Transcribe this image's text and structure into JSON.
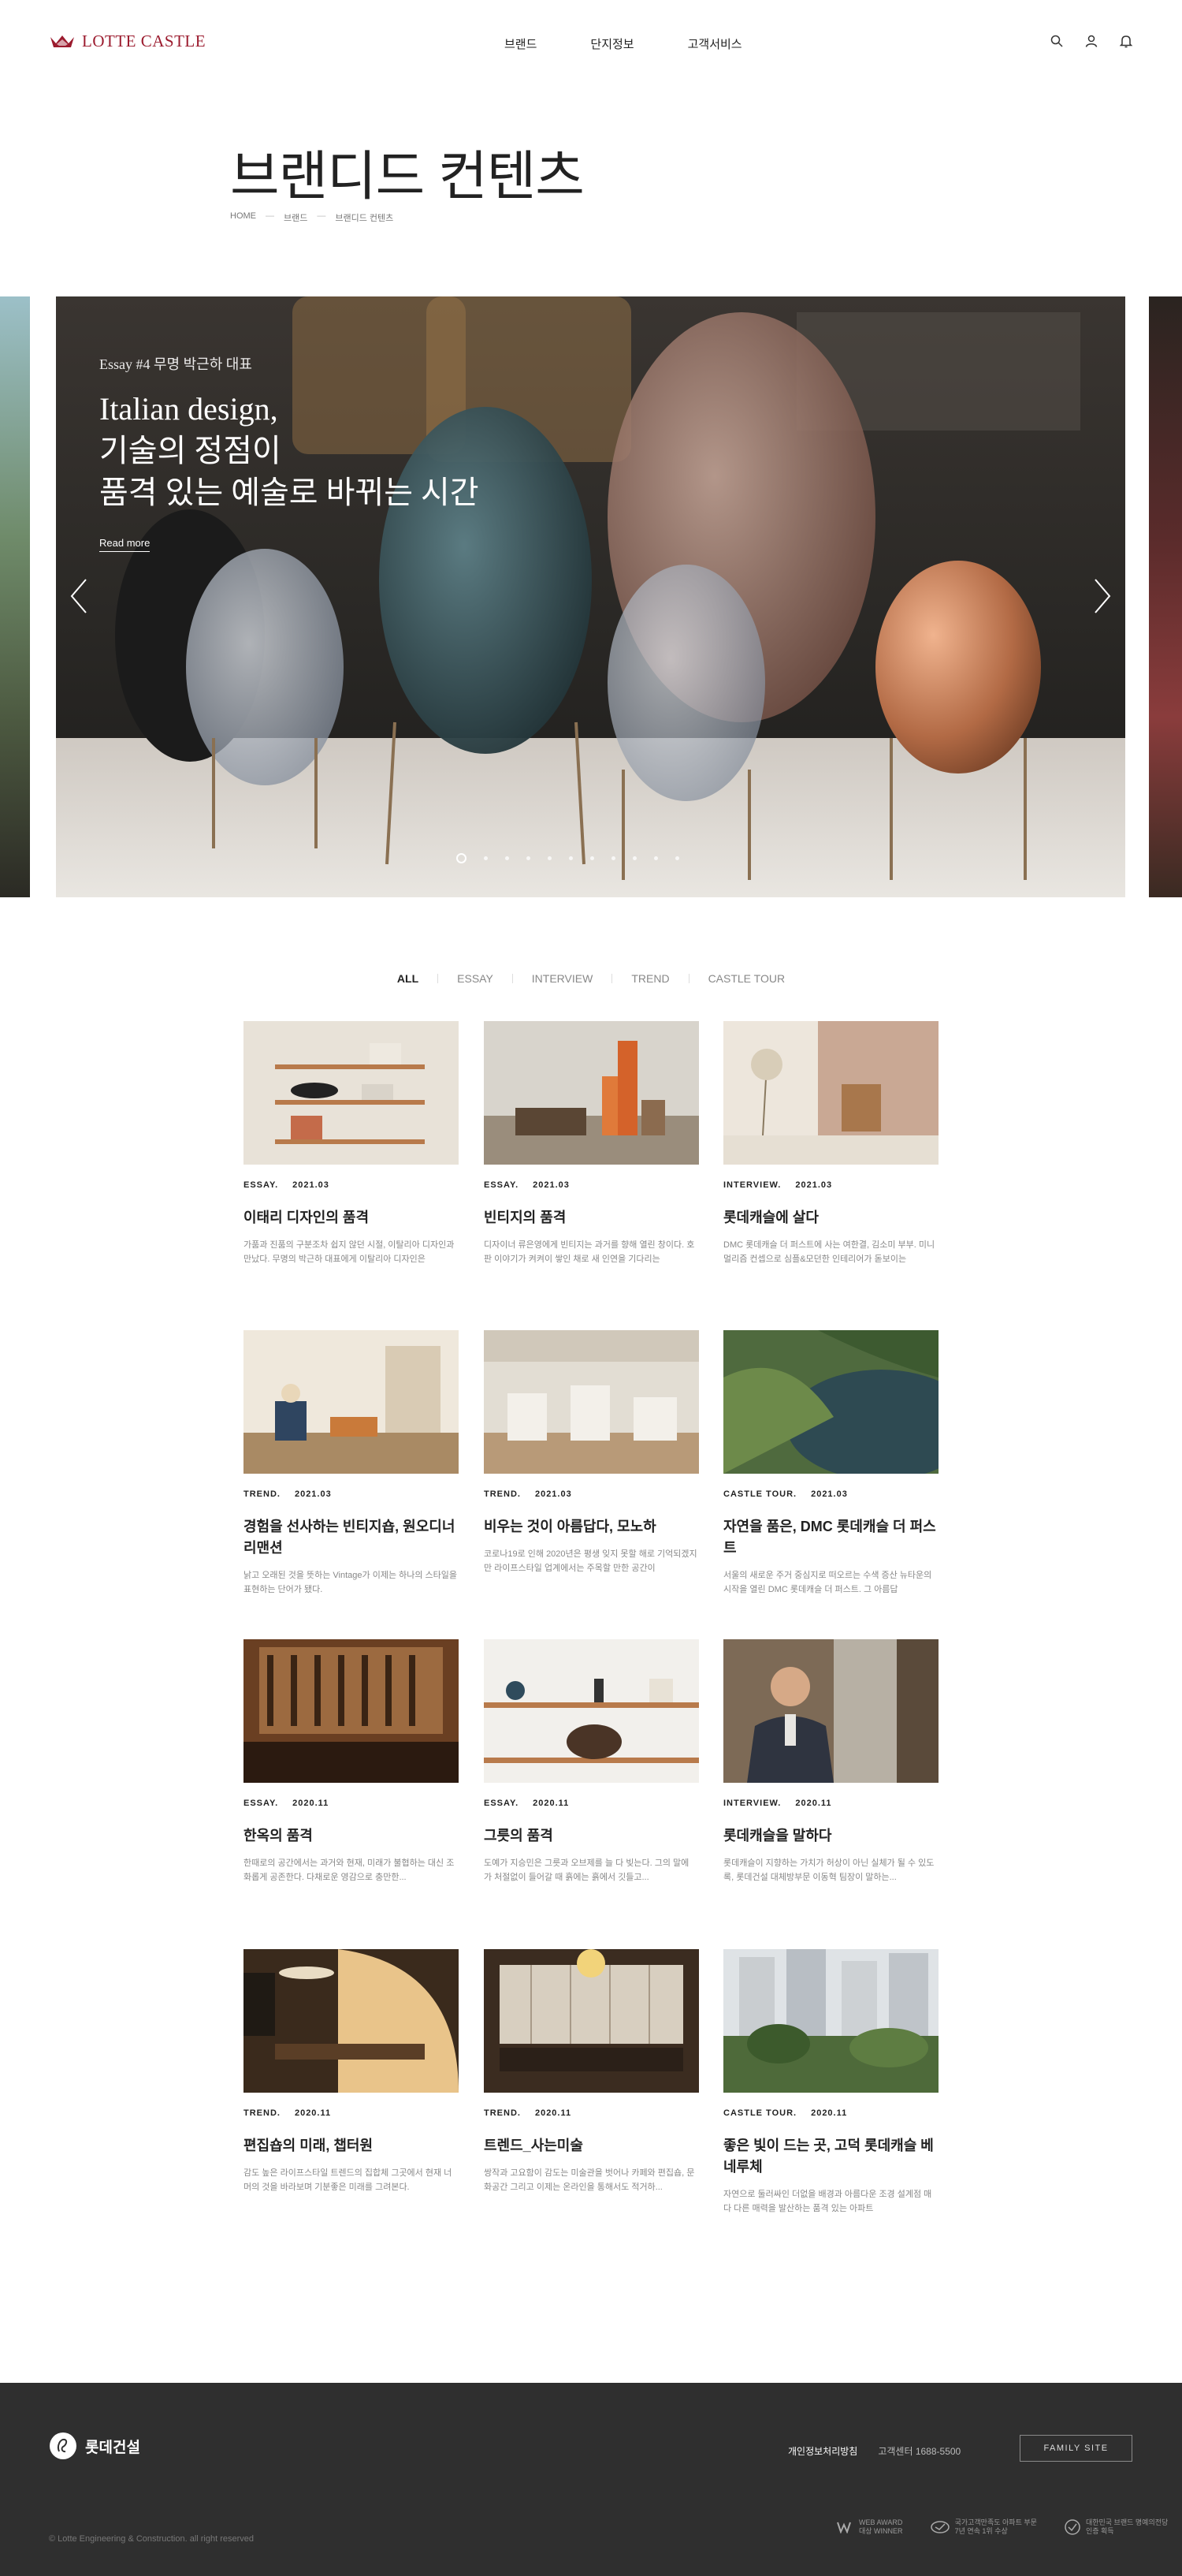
{
  "header": {
    "logo_text": "LOTTE CASTLE",
    "nav": [
      "브랜드",
      "단지정보",
      "고객서비스"
    ]
  },
  "page": {
    "title": "브랜디드 컨텐츠",
    "breadcrumb": [
      "HOME",
      "브랜드",
      "브랜디드 컨텐츠"
    ]
  },
  "hero": {
    "category": "Essay #4 무명 박근하 대표",
    "headline": "Italian design,\n기술의 정점이\n품격 있는 예술로 바뀌는 시간",
    "read_more": "Read more",
    "slide_count": 11,
    "active_slide": 0
  },
  "tabs": {
    "items": [
      "ALL",
      "ESSAY",
      "INTERVIEW",
      "TREND",
      "CASTLE TOUR"
    ],
    "active": 0
  },
  "cards": [
    {
      "category": "ESSAY.",
      "date": "2021.03",
      "title": "이태리 디자인의 품격",
      "desc": "가품과 진품의 구분조차 쉽지 않던 시절, 이탈리아 디자인과 만났다. 무명의 박근하 대표에게 이탈리아 디자인은"
    },
    {
      "category": "ESSAY.",
      "date": "2021.03",
      "title": "빈티지의 품격",
      "desc": "디자이너 류은영에게 빈티지는 과거를 향해 열린 창이다. 호판 이야기가 켜켜이 쌓인 채로 새 인연을 기다리는"
    },
    {
      "category": "INTERVIEW.",
      "date": "2021.03",
      "title": "롯데캐슬에 살다",
      "desc": "DMC 롯데캐슬 더 퍼스트에 사는 여한결, 김소미 부부. 미니멀리즘 컨셉으로 심플&모던한 인테리어가 돋보이는"
    },
    {
      "category": "TREND.",
      "date": "2021.03",
      "title": "경험을 선사하는 빈티지숍, 원오디너리맨션",
      "desc": "낡고 오래된 것을 뜻하는 Vintage가 이제는 하나의 스타일을 표현하는 단어가 됐다."
    },
    {
      "category": "TREND.",
      "date": "2021.03",
      "title": "비우는 것이 아름답다, 모노하",
      "desc": "코로나19로 인해 2020년은 평생 잊지 못할 해로 기억되겠지만 라이프스타일 업계에서는 주목할 만한 공간이"
    },
    {
      "category": "CASTLE TOUR.",
      "date": "2021.03",
      "title": "자연을 품은, DMC 롯데캐슬 더 퍼스트",
      "desc": "서울의 새로운 주거 중심지로 떠오르는 수색 증산 뉴타운의 시작을 열린 DMC 롯데캐슬 더 퍼스트. 그 아름답"
    },
    {
      "category": "ESSAY.",
      "date": "2020.11",
      "title": "한옥의 품격",
      "desc": "한때로의 공간에서는 과거와 현재, 미래가 불협하는 대신 조화롭게 공존한다. 다채로운 영감으로 충만한..."
    },
    {
      "category": "ESSAY.",
      "date": "2020.11",
      "title": "그릇의 품격",
      "desc": "도예가 지승민은 그릇과 오브제를 늘 다 빚는다. 그의 말에 가 처절없이 들어갈 때 흙에는 흙에서 깃들고..."
    },
    {
      "category": "INTERVIEW.",
      "date": "2020.11",
      "title": "롯데캐슬을 말하다",
      "desc": "롯데캐슬이 지향하는 가치가 허상이 아닌 실체가 될 수 있도록, 롯데건설 대체방부문 이동혁 팀장이 말하는..."
    },
    {
      "category": "TREND.",
      "date": "2020.11",
      "title": "편집숍의 미래, 챕터원",
      "desc": "감도 높은 라이프스타일 트렌드의 집합체 그곳에서 현재 너머의 것을 바라보며 기분좋은 미래를 그려본다."
    },
    {
      "category": "TREND.",
      "date": "2020.11",
      "title": "트렌드_사는미술",
      "desc": "쌍작과 고요함이 감도는 미술관을 벗어나 카페와 편집숍, 문화공간 그리고 이제는 온라인을 통해서도 적거하..."
    },
    {
      "category": "CASTLE TOUR.",
      "date": "2020.11",
      "title": "좋은 빛이 드는 곳, 고덕 롯데캐슬 베네루체",
      "desc": "자연으로 둘러싸인 더없을 배경과 아름다운 조경 설계점 매다 다른 매력을 발산하는 품격 있는 아파트"
    }
  ],
  "footer": {
    "logo_text": "롯데건설",
    "privacy": "개인정보처리방침",
    "call_center": "고객센터 1688-5500",
    "family_site": "FAMILY SITE",
    "copyright": "© Lotte Engineering & Construction. all right reserved",
    "awards": [
      "WEB AWARD\n대상 WINNER",
      "국가고객만족도 아파트 부문\n7년 연속 1위 수상",
      "대한민국 브랜드 명예의전당\n인증 획득"
    ]
  },
  "colors": {
    "brand": "#9b1b2e",
    "footer_bg": "#2f2f2f"
  }
}
